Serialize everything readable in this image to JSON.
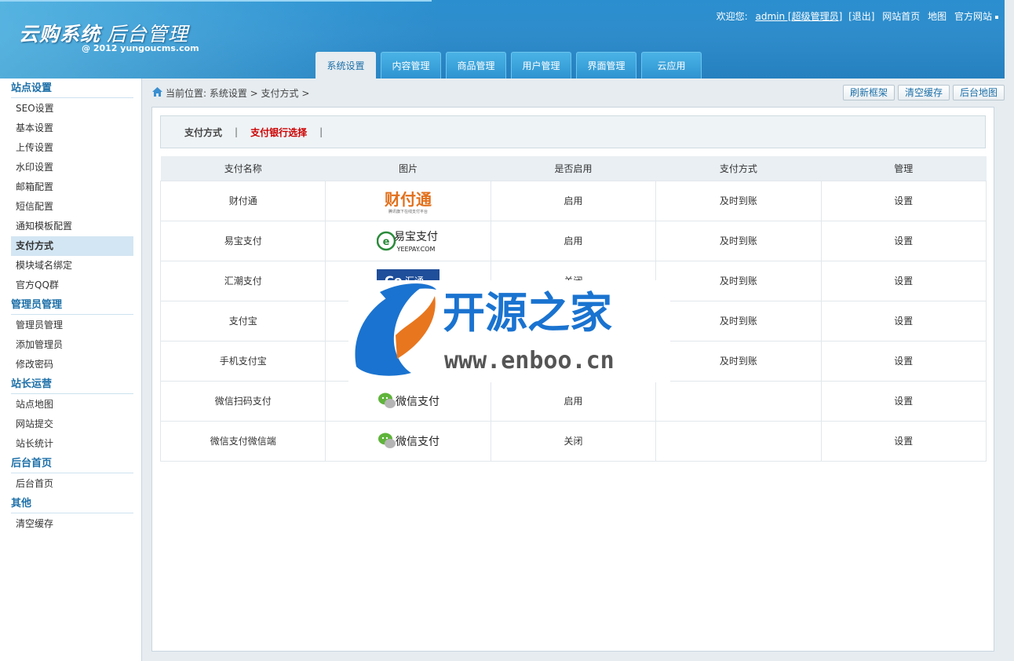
{
  "header": {
    "logo_title": "云购系统",
    "logo_subtitle": "后台管理",
    "logo_copyright": "@ 2012 yungoucms.com",
    "welcome": "欢迎您:",
    "admin_user": "admin [超级管理员]",
    "logout": "[退出]",
    "site_home": "网站首页",
    "sitemap": "地图",
    "official_site": "官方网站"
  },
  "tabs": [
    {
      "label": "系统设置",
      "active": true
    },
    {
      "label": "内容管理"
    },
    {
      "label": "商品管理"
    },
    {
      "label": "用户管理"
    },
    {
      "label": "界面管理"
    },
    {
      "label": "云应用"
    }
  ],
  "sidebar": {
    "groups": [
      {
        "title": "站点设置",
        "items": [
          "SEO设置",
          "基本设置",
          "上传设置",
          "水印设置",
          "邮箱配置",
          "短信配置",
          "通知模板配置",
          "支付方式",
          "模块域名绑定",
          "官方QQ群"
        ]
      },
      {
        "title": "管理员管理",
        "items": [
          "管理员管理",
          "添加管理员",
          "修改密码"
        ]
      },
      {
        "title": "站长运营",
        "items": [
          "站点地图",
          "网站提交",
          "站长统计"
        ]
      },
      {
        "title": "后台首页",
        "items": [
          "后台首页"
        ]
      },
      {
        "title": "其他",
        "items": [
          "清空缓存"
        ]
      }
    ],
    "active_item": "支付方式"
  },
  "breadcrumb": "当前位置: 系统设置 > 支付方式 >",
  "toolbar": {
    "refresh_label": "刷新框架",
    "clear_cache_label": "清空缓存",
    "admin_map_label": "后台地图"
  },
  "subtabs": {
    "payment_methods": "支付方式",
    "bank_select": "支付银行选择",
    "separator": "|"
  },
  "table": {
    "headers": [
      "支付名称",
      "图片",
      "是否启用",
      "支付方式",
      "管理"
    ],
    "rows": [
      {
        "name": "财付通",
        "logo": "财付通",
        "logo_small": "腾讯旗下在线支付平台",
        "status": "启用",
        "mode": "及时到账",
        "action": "设置"
      },
      {
        "name": "易宝支付",
        "logo": "易宝支付",
        "logo_small": "YEEPAY.COM",
        "status": "启用",
        "mode": "及时到账",
        "action": "设置"
      },
      {
        "name": "汇潮支付",
        "logo": "汇通",
        "status": "关闭",
        "mode": "及时到账",
        "action": "设置"
      },
      {
        "name": "支付宝",
        "logo": "",
        "status": "",
        "mode": "及时到账",
        "action": "设置"
      },
      {
        "name": "手机支付宝",
        "logo": "",
        "status": "",
        "mode": "及时到账",
        "action": "设置"
      },
      {
        "name": "微信扫码支付",
        "logo": "微信支付",
        "status": "启用",
        "mode": "",
        "action": "设置"
      },
      {
        "name": "微信支付微信端",
        "logo": "微信支付",
        "status": "关闭",
        "mode": "",
        "action": "设置"
      }
    ]
  },
  "watermark": {
    "name": "开源之家",
    "url": "www.enboo.cn"
  },
  "colors": {
    "header_blue": "#2b8fcf",
    "enabled": "#1a9a1a",
    "disabled": "#d01010",
    "accent": "#1c6fa8"
  }
}
